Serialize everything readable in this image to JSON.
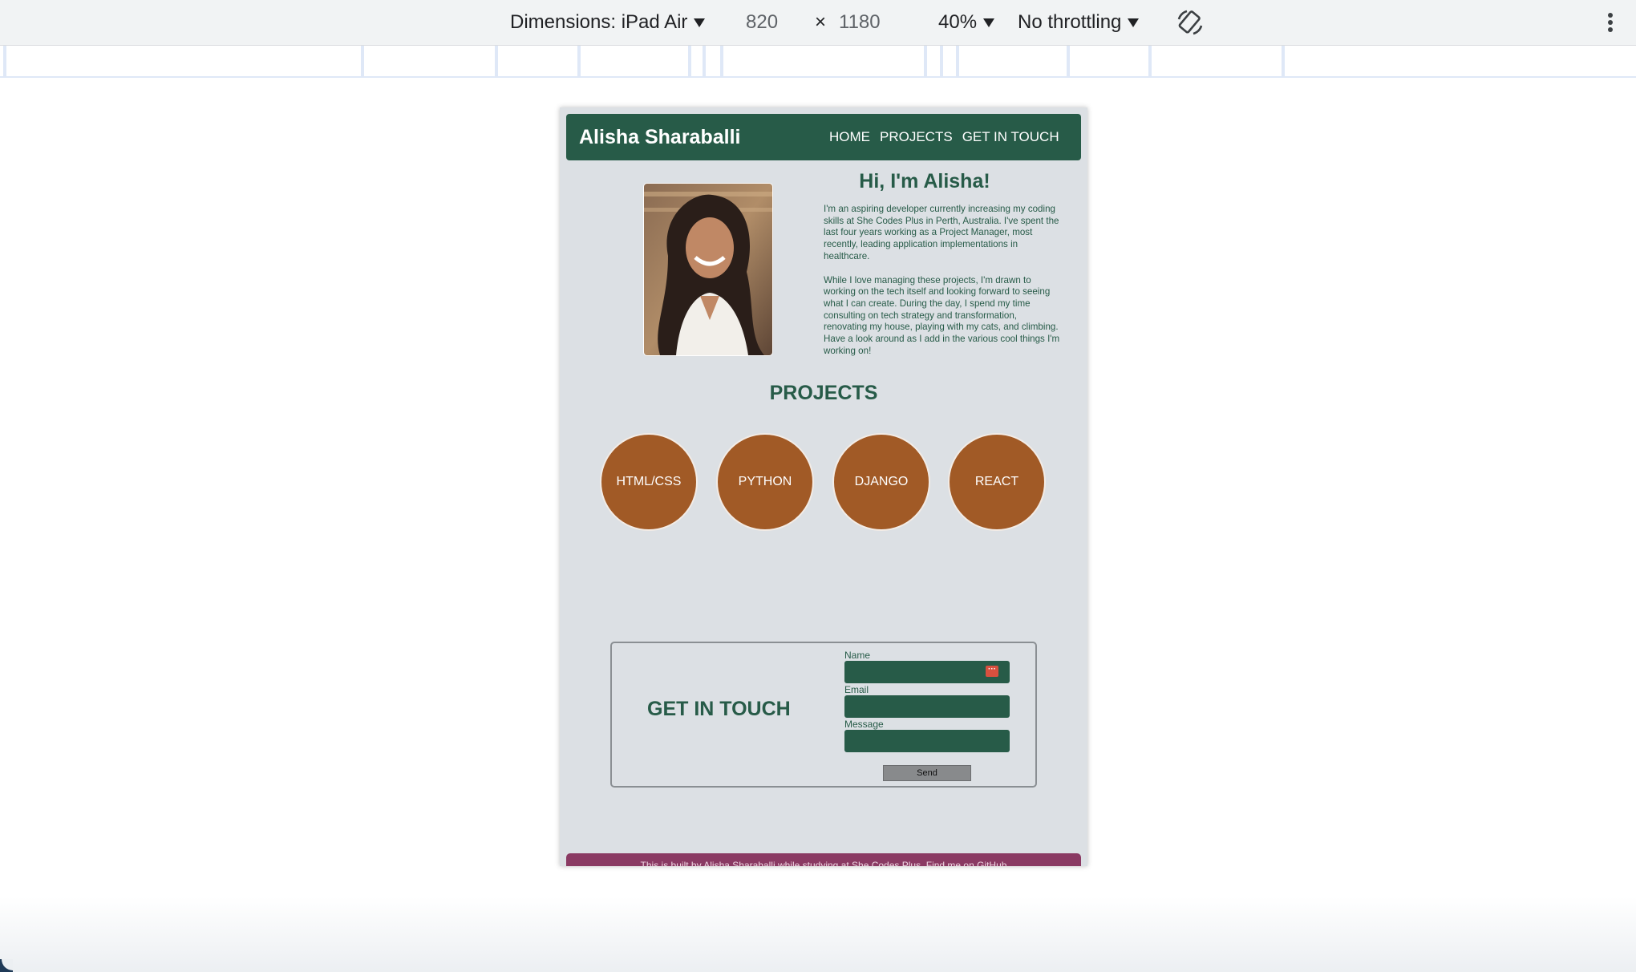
{
  "devtools": {
    "dimensions_label": "Dimensions: iPad Air",
    "width": "820",
    "times_symbol": "×",
    "height": "1180",
    "zoom": "40%",
    "throttling": "No throttling",
    "rotate_icon": "rotate-icon",
    "more_icon": "more-vertical-icon"
  },
  "site": {
    "brand": "Alisha Sharaballi",
    "nav": [
      "HOME",
      "PROJECTS",
      "GET IN TOUCH"
    ],
    "hero_title": "Hi, I'm Alisha!",
    "bio": [
      "I'm an aspiring developer currently increasing my coding skills at She Codes Plus in Perth, Australia. I've spent the last four years working as a Project Manager, most recently, leading application implementations in healthcare.",
      "While I love managing these projects, I'm drawn to working on the tech itself and looking forward to seeing what I can create. During the day, I spend my time consulting on tech strategy and transformation, renovating my house, playing with my cats, and climbing. Have a look around as I add in the various cool things I'm working on!"
    ],
    "projects_title": "PROJECTS",
    "projects": [
      "HTML/CSS",
      "PYTHON",
      "DJANGO",
      "REACT"
    ],
    "contact": {
      "title": "GET IN TOUCH",
      "name_label": "Name",
      "email_label": "Email",
      "message_label": "Message",
      "send_label": "Send"
    },
    "footer_text": "This is built by Alisha Sharaballi while studying at She Codes Plus. Find me on GitHub"
  },
  "colors": {
    "primary_green": "#275b48",
    "project_orange": "#a15a26",
    "page_bg": "#dce0e4",
    "footer_bg": "#8a3a63"
  }
}
